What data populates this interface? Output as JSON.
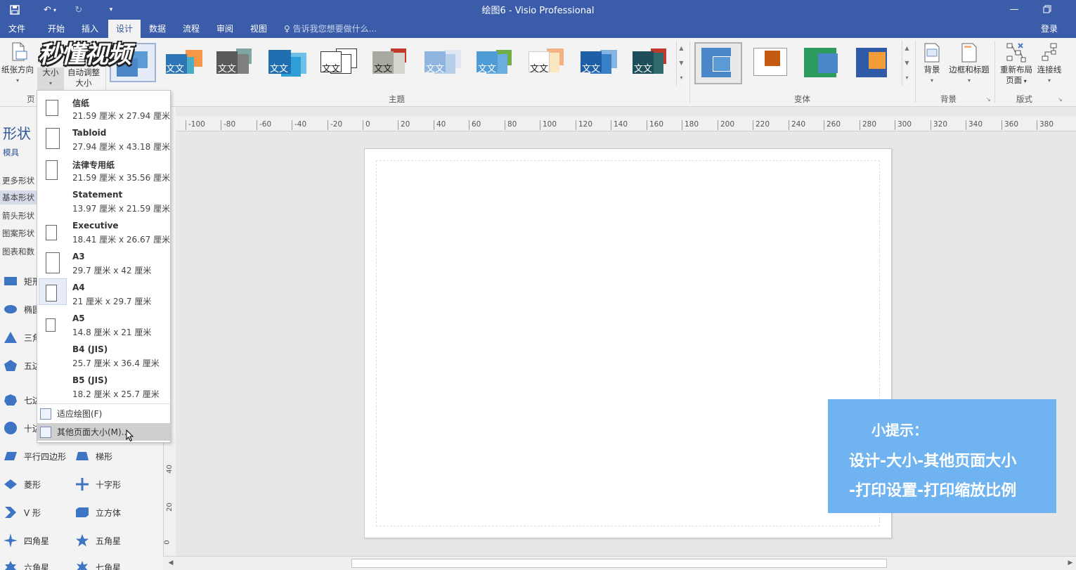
{
  "window": {
    "title": "绘图6 - Visio Professional"
  },
  "tabs": [
    {
      "label": "文件"
    },
    {
      "label": "开始"
    },
    {
      "label": "插入"
    },
    {
      "label": "设计"
    },
    {
      "label": "数据"
    },
    {
      "label": "流程"
    },
    {
      "label": "审阅"
    },
    {
      "label": "视图"
    }
  ],
  "active_tab": "设计",
  "tellme": "告诉我您想要做什么...",
  "login": "登录",
  "ribbon": {
    "orientation_label": "纸张方向",
    "size_label": "大小",
    "autofit_line1": "自动调整",
    "autofit_line2": "大小",
    "page_group_label": "页",
    "themes_label": "主题",
    "theme_text": "文文",
    "variants_label": "变体",
    "background_label": "背景",
    "background_btn": "背景",
    "borders_btn": "边框和标题",
    "relayout_line1": "重新布局",
    "relayout_line2": "页面",
    "connectors_btn": "连接线",
    "layout_label": "版式",
    "theme_colors": [
      [
        "#4a86c8",
        "#5b9bd5",
        "#ffc000"
      ],
      [
        "#2e75b6",
        "#4bacc6",
        "#f79646"
      ],
      [
        "#595959",
        "#7f7f7f",
        "#7fa6a0"
      ],
      [
        "#1f6fb2",
        "#2f9fd8",
        "#6fc0e8"
      ],
      [
        "#ffffff",
        "#ffffff",
        "#ffffff"
      ],
      [
        "#a9a9a0",
        "#d6d6ce",
        "#c0392b"
      ],
      [
        "#8fb4de",
        "#b7cfe9",
        "#dde8f4"
      ],
      [
        "#4f9bd6",
        "#6aaee0",
        "#70ad47"
      ],
      [
        "#ffffff",
        "#f9e7c0",
        "#f4b183"
      ],
      [
        "#1f5fa7",
        "#3a80c9",
        "#86b4e0"
      ],
      [
        "#1e4e5a",
        "#2e6b6e",
        "#c0392b"
      ]
    ],
    "variant_colors": [
      [
        "#4a86c8",
        "#5b9bd5"
      ],
      [
        "#c55a11",
        "#ffffff"
      ],
      [
        "#2e9b5e",
        "#4a86c8"
      ],
      [
        "#2e5aa8",
        "#f29d38"
      ]
    ]
  },
  "logo_text": "秒懂视频",
  "shapes": {
    "title": "形状",
    "stencils": "模具",
    "categories": [
      "更多形状",
      "基本形状",
      "箭头形状",
      "图案形状",
      "图表和数"
    ],
    "selected_category": "基本形状",
    "items": [
      {
        "name": "矩形",
        "icon": "rectangle-icon"
      },
      {
        "name": "椭圆",
        "icon": "ellipse-icon"
      },
      {
        "name": "三角",
        "icon": "triangle-icon"
      },
      {
        "name": "五边",
        "icon": "pentagon-icon"
      },
      {
        "name": "七边",
        "icon": "heptagon-icon"
      },
      {
        "name": "十边",
        "icon": "decagon-icon"
      },
      {
        "name": "平行四边形",
        "icon": "parallelogram-icon"
      },
      {
        "name": "梯形",
        "icon": "trapezoid-icon"
      },
      {
        "name": "菱形",
        "icon": "diamond-icon"
      },
      {
        "name": "十字形",
        "icon": "cross-icon"
      },
      {
        "name": "V 形",
        "icon": "chevron-icon"
      },
      {
        "name": "立方体",
        "icon": "cube-icon"
      },
      {
        "name": "四角星",
        "icon": "star4-icon"
      },
      {
        "name": "五角星",
        "icon": "star5-icon"
      },
      {
        "name": "六角星",
        "icon": "star6-icon"
      },
      {
        "name": "七角星",
        "icon": "star7-icon"
      }
    ]
  },
  "size_menu": {
    "items": [
      {
        "name": "信纸",
        "dims": "21.59 厘米 x 27.94 厘米"
      },
      {
        "name": "Tabloid",
        "dims": "27.94 厘米 x 43.18 厘米"
      },
      {
        "name": "法律专用纸",
        "dims": "21.59 厘米 x 35.56 厘米"
      },
      {
        "name": "Statement",
        "dims": "13.97 厘米 x 21.59 厘米"
      },
      {
        "name": "Executive",
        "dims": "18.41 厘米 x 26.67 厘米"
      },
      {
        "name": "A3",
        "dims": "29.7 厘米 x 42 厘米"
      },
      {
        "name": "A4",
        "dims": "21 厘米 x 29.7 厘米"
      },
      {
        "name": "A5",
        "dims": "14.8 厘米 x 21 厘米"
      },
      {
        "name": "B4 (JIS)",
        "dims": "25.7 厘米 x 36.4 厘米"
      },
      {
        "name": "B5 (JIS)",
        "dims": "18.2 厘米 x 25.7 厘米"
      }
    ],
    "selected": "A4",
    "fit_drawing": "适应绘图(F)",
    "more_sizes": "其他页面大小(M)..."
  },
  "ruler": {
    "h_ticks": [
      "-100",
      "-80",
      "-60",
      "-40",
      "-20",
      "0",
      "20",
      "40",
      "60",
      "80",
      "100",
      "120",
      "140",
      "160",
      "180",
      "200",
      "220",
      "240",
      "260",
      "280",
      "300",
      "320",
      "340",
      "360",
      "380"
    ],
    "v_ticks": [
      "40",
      "20",
      "0"
    ]
  },
  "tip": {
    "line1": "小提示：",
    "line2": "设计-大小-其他页面大小",
    "line3": "-打印设置-打印缩放比例"
  }
}
